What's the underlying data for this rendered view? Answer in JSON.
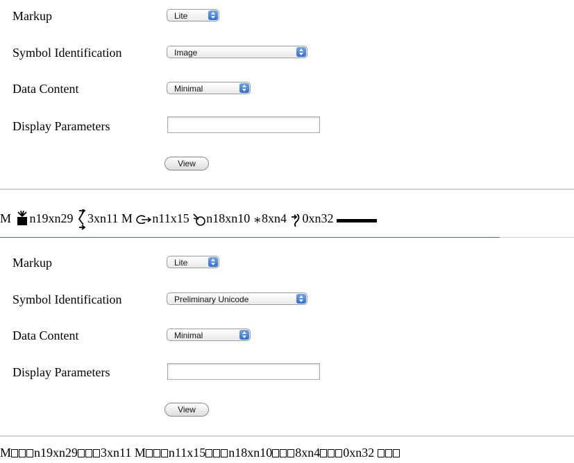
{
  "form1": {
    "markup_label": "Markup",
    "markup_value": "Lite",
    "symbol_id_label": "Symbol Identification",
    "symbol_id_value": "Image",
    "data_content_label": "Data Content",
    "data_content_value": "Minimal",
    "display_params_label": "Display Parameters",
    "display_params_value": "",
    "view_button": "View"
  },
  "output1": {
    "t1": "M ",
    "t2": "n19xn29 ",
    "t3": "3xn11 M ",
    "t4": "n11x15 ",
    "t5": "n18xn10 ",
    "t6": "8xn4 ",
    "t7": "0xn32 "
  },
  "form2": {
    "markup_label": "Markup",
    "markup_value": "Lite",
    "symbol_id_label": "Symbol Identification",
    "symbol_id_value": "Preliminary Unicode",
    "data_content_label": "Data Content",
    "data_content_value": "Minimal",
    "display_params_label": "Display Parameters",
    "display_params_value": "",
    "view_button": "View"
  },
  "output2": {
    "t1": "M",
    "t2": "n19xn29",
    "t3": "3xn11 M",
    "t4": "n11x15",
    "t5": "n18xn10",
    "t6": "8xn4",
    "t7": "0xn32 "
  }
}
